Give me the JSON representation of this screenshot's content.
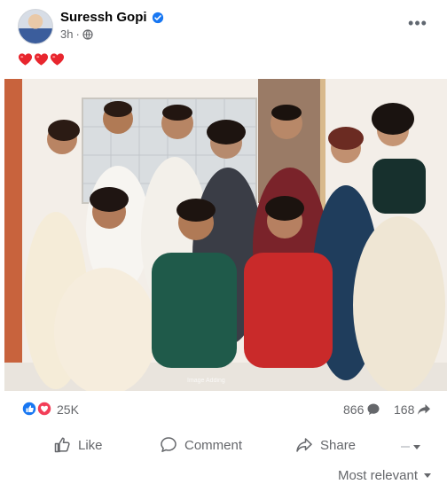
{
  "post": {
    "author": "Suressh Gopi",
    "time": "3h",
    "visibility_icon": "globe-icon",
    "verified_icon": "verified-badge-icon",
    "caption_icons": [
      "heart-icon",
      "heart-icon",
      "heart-icon"
    ],
    "more_icon": "more-horizontal-icon"
  },
  "image": {
    "watermark": "Image Adding"
  },
  "stats": {
    "reactions": "25K",
    "comments": "866",
    "shares": "168"
  },
  "actions": {
    "like": "Like",
    "comment": "Comment",
    "share": "Share"
  },
  "sort": {
    "label": "Most relevant"
  },
  "colors": {
    "facebook_blue": "#1877f2",
    "love_red": "#f33e58",
    "secondary_text": "#65676b"
  }
}
